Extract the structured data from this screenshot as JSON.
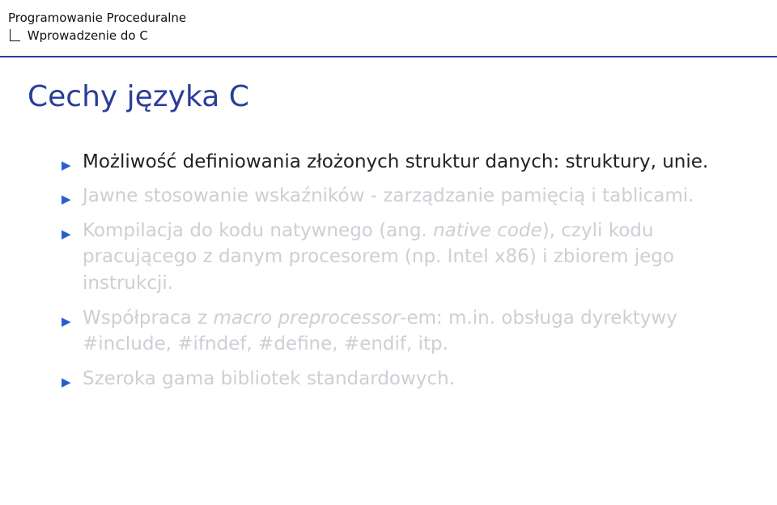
{
  "header": {
    "line1": "Programowanie Proceduralne",
    "line2": "Wprowadzenie do C"
  },
  "title": "Cechy języka C",
  "bullets": [
    {
      "state": "active",
      "runs": [
        {
          "text": "Możliwość definiowania złożonych struktur danych: struktury, unie."
        }
      ]
    },
    {
      "state": "muted",
      "runs": [
        {
          "text": "Jawne stosowanie wskaźników - zarządzanie pamięcią i tablicami."
        }
      ]
    },
    {
      "state": "muted",
      "runs": [
        {
          "text": "Kompilacja do kodu natywnego (ang. "
        },
        {
          "text": "native code",
          "italic": true
        },
        {
          "text": "), czyli kodu pracującego z danym procesorem (np. Intel x86) i zbiorem jego instrukcji."
        }
      ]
    },
    {
      "state": "muted",
      "runs": [
        {
          "text": "Współpraca z "
        },
        {
          "text": "macro preprocessor",
          "italic": true
        },
        {
          "text": "-em: m.in. obsługa dyrektywy "
        },
        {
          "text": "#include",
          "kw": true
        },
        {
          "text": ", "
        },
        {
          "text": "#ifndef",
          "kw": true
        },
        {
          "text": ", "
        },
        {
          "text": "#define",
          "kw": true
        },
        {
          "text": ", "
        },
        {
          "text": "#endif",
          "kw": true
        },
        {
          "text": ", itp."
        }
      ]
    },
    {
      "state": "muted",
      "runs": [
        {
          "text": "Szeroka gama bibliotek standardowych."
        }
      ]
    }
  ]
}
